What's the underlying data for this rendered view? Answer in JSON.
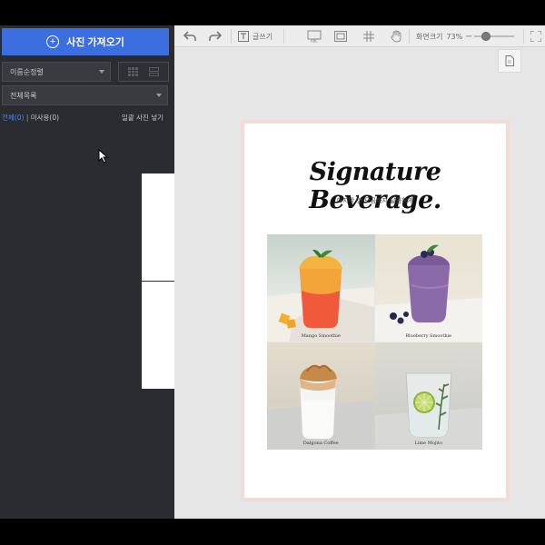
{
  "sidebar": {
    "import_button": "사진 가져오기",
    "sort_select": "이름순정렬",
    "list_select": "전체목록",
    "filter": {
      "all": "전체(0)",
      "separator": " | ",
      "unused": "미사용(0)",
      "bulk_insert": "일괄 사진 넣기"
    }
  },
  "toolbar": {
    "text_tool_label": "글쓰기",
    "zoom_label": "화면크기",
    "zoom_value": "73%"
  },
  "page": {
    "title": "Signature Beverage.",
    "subtitle": "마지막 한 모금까지 달콤하게",
    "items": [
      {
        "label": "Mango Smoothie"
      },
      {
        "label": "Blueberry Smoothie"
      },
      {
        "label": "Dalgona Coffee"
      },
      {
        "label": "Lime Mojito"
      }
    ]
  },
  "colors": {
    "accent": "#3b6fe0",
    "sidebar_bg": "#2b2c30",
    "page_border": "#f3dcd8",
    "link_blue": "#4a86ff"
  }
}
